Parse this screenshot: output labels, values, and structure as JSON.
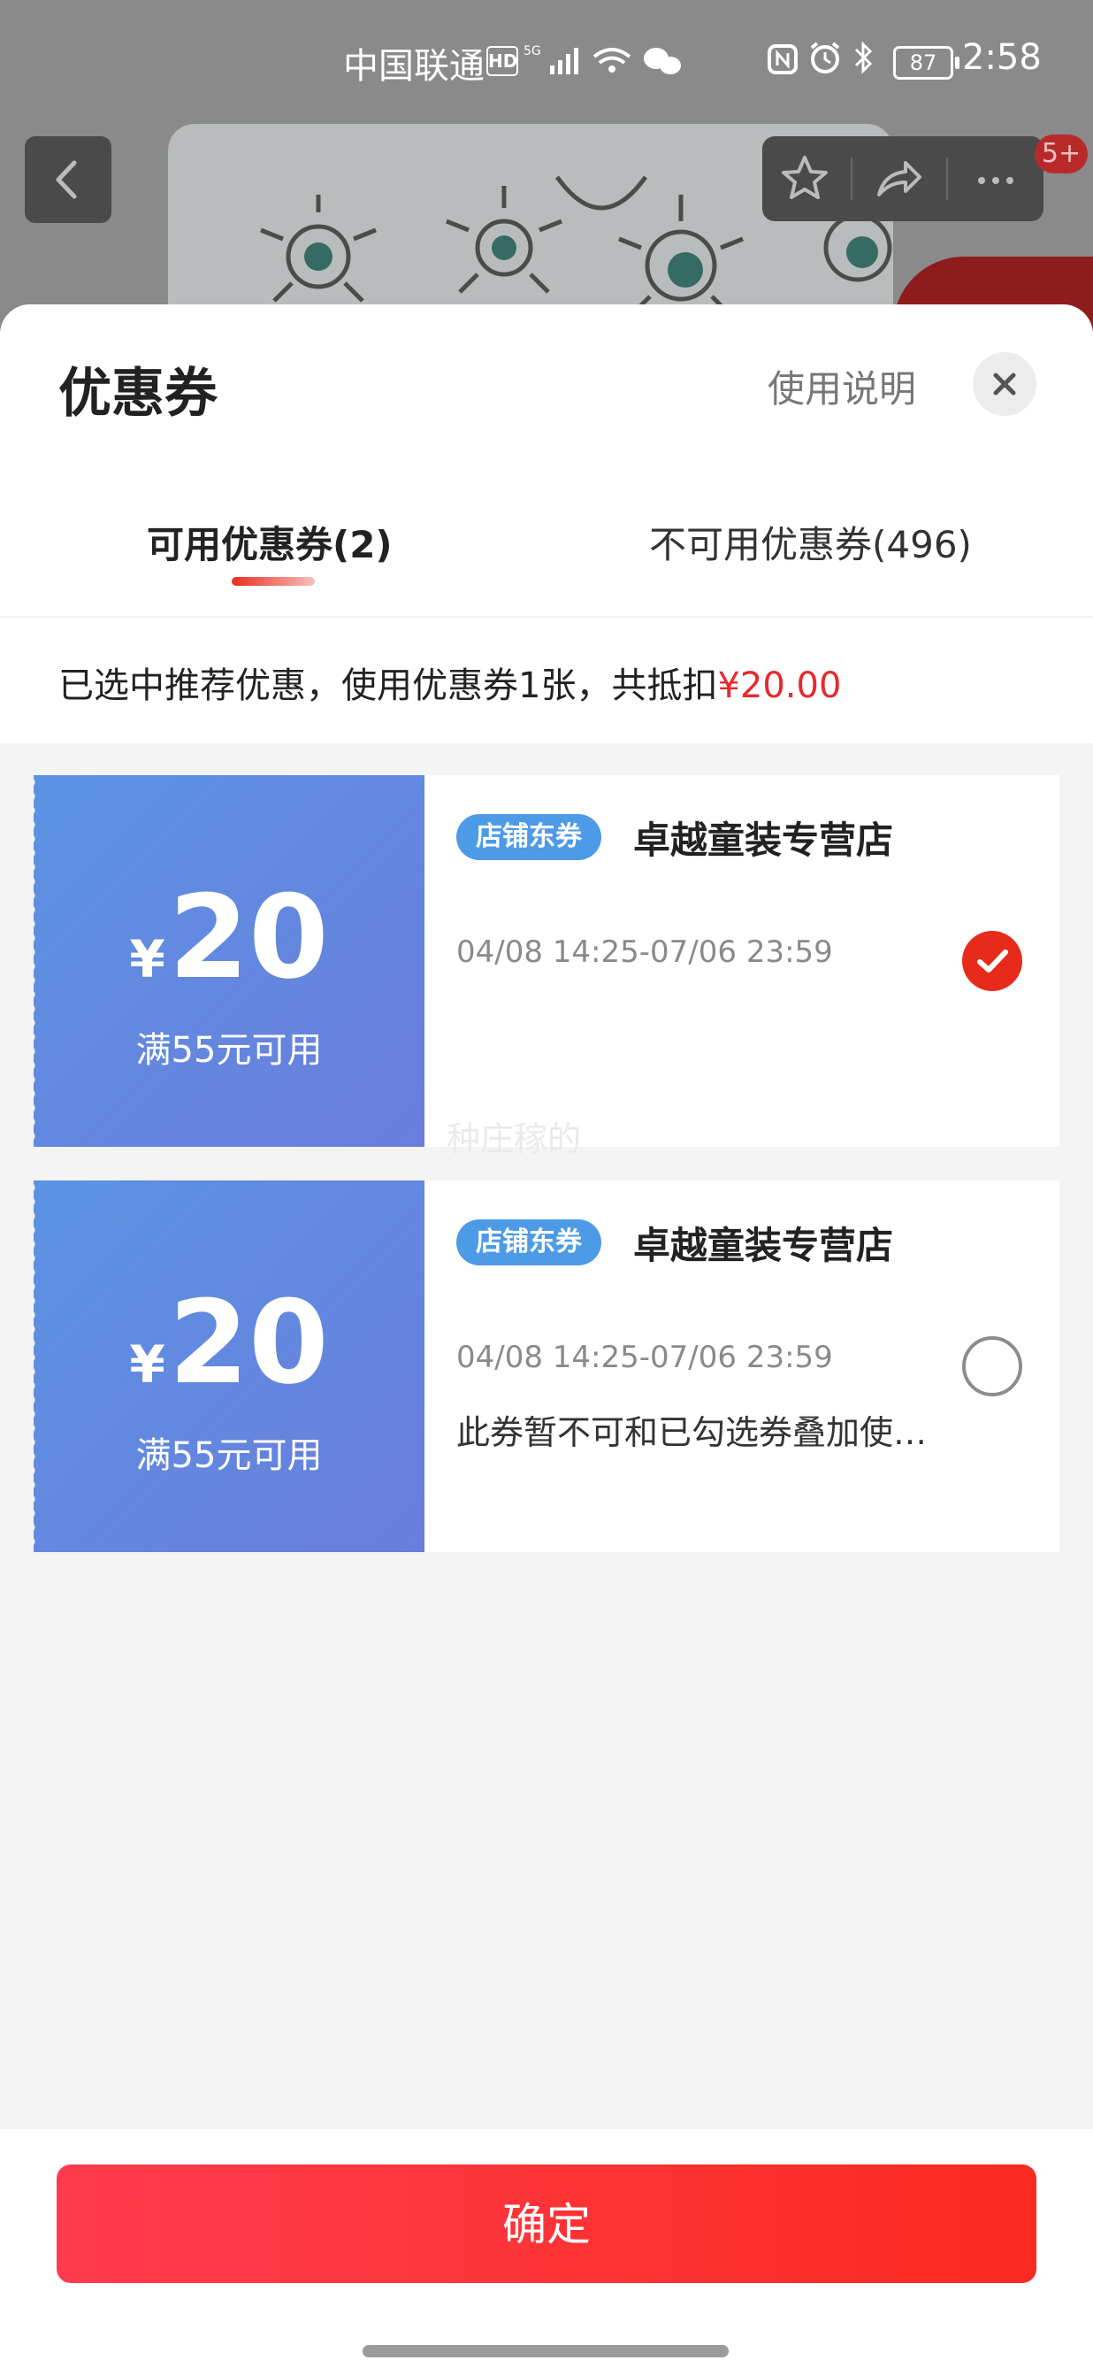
{
  "status_bar": {
    "carrier": "中国联通",
    "hd": "HD",
    "battery": "87",
    "time": "2:58"
  },
  "header_actions": {
    "notification_badge": "5+"
  },
  "sheet": {
    "title": "优惠券",
    "help_link": "使用说明",
    "tabs": [
      {
        "label": "可用优惠券(2)",
        "active": true
      },
      {
        "label": "不可用优惠券(496)",
        "active": false
      }
    ],
    "summary_prefix": "已选中推荐优惠，使用优惠券1张，共抵扣",
    "summary_amount": "¥20.00"
  },
  "coupons": [
    {
      "currency": "¥",
      "amount": "20",
      "condition": "满55元可用",
      "tag": "店铺东券",
      "shop": "卓越童装专营店",
      "validity": "04/08 14:25-07/06 23:59",
      "note": "",
      "selected": true
    },
    {
      "currency": "¥",
      "amount": "20",
      "condition": "满55元可用",
      "tag": "店铺东券",
      "shop": "卓越童装专营店",
      "validity": "04/08 14:25-07/06 23:59",
      "note": "此券暂不可和已勾选券叠加使…",
      "selected": false
    }
  ],
  "watermark": "种庄稼的",
  "confirm_label": "确定",
  "colors": {
    "accent_red": "#e8282b",
    "coupon_blue_start": "#5b93e4",
    "coupon_blue_end": "#6a7ddb",
    "tag_blue": "#4d9be6"
  },
  "icons": [
    "back-icon",
    "star-icon",
    "share-icon",
    "more-icon",
    "close-icon",
    "check-icon"
  ]
}
